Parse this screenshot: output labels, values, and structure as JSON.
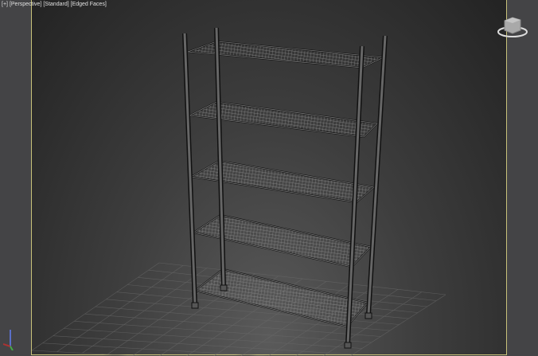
{
  "viewport": {
    "labels": [
      "[+]",
      "[Perspective]",
      "[Standard]",
      "[Edged Faces]"
    ]
  },
  "colors": {
    "active_border": "#c8c27a",
    "wire": "#0a0a0a",
    "metal": "#6a6a6a"
  }
}
